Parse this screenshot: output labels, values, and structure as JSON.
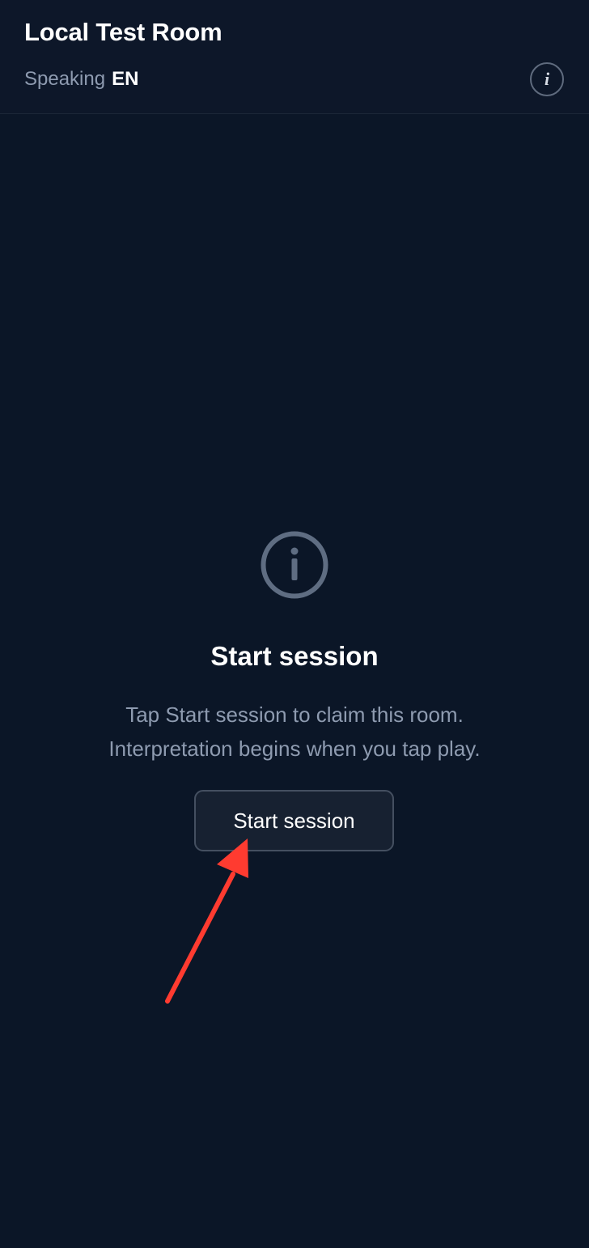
{
  "header": {
    "room_title": "Local Test Room",
    "speaking_label": "Speaking",
    "speaking_language": "EN",
    "info_button_glyph": "i"
  },
  "empty_state": {
    "icon": "info-circle-icon",
    "title": "Start session",
    "description_line1": "Tap Start session to claim this room.",
    "description_line2": "Interpretation begins when you tap play.",
    "start_button_label": "Start session"
  },
  "annotation": {
    "arrow_color": "#ff3b30"
  },
  "colors": {
    "background": "#0b1627",
    "muted_text": "#8e9bb0",
    "icon_gray": "#5f6d82"
  }
}
